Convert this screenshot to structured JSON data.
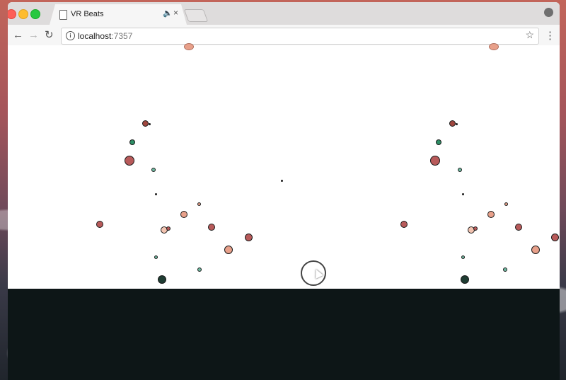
{
  "tab": {
    "title": "VR Beats",
    "audio_glyph": "🔈",
    "close_glyph": "×"
  },
  "toolbar": {
    "back_glyph": "←",
    "forward_glyph": "→",
    "reload_glyph": "↻",
    "url_host": "localhost",
    "url_port": ":7357",
    "star_glyph": "☆",
    "menu_glyph": "⋮"
  },
  "scene": {
    "sky_color": "#ffffff",
    "ground_color": "#0d1617",
    "particle_colors": [
      "#b85a5a",
      "#e8a08a",
      "#2e8f66",
      "#6fb9a0",
      "#1f3d33",
      "#a0473f"
    ]
  }
}
